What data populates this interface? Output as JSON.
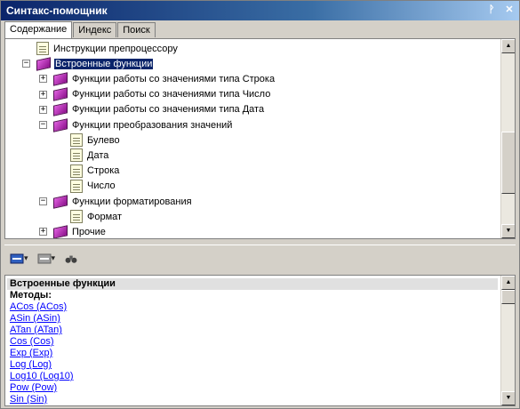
{
  "window": {
    "title": "Синтакс-помощник"
  },
  "tabs": [
    {
      "label": "Содержание",
      "active": true
    },
    {
      "label": "Индекс",
      "active": false
    },
    {
      "label": "Поиск",
      "active": false
    }
  ],
  "tree": [
    {
      "label": "Инструкции препроцессору",
      "icon": "document-icon",
      "expander": "",
      "selected": false
    },
    {
      "label": "Встроенные функции",
      "icon": "book-icon",
      "expander": "−",
      "selected": true
    },
    {
      "label": "Функции работы со значениями типа Строка",
      "icon": "book-icon",
      "expander": "+",
      "selected": false
    },
    {
      "label": "Функции работы со значениями типа Число",
      "icon": "book-icon",
      "expander": "+",
      "selected": false
    },
    {
      "label": "Функции работы со значениями типа Дата",
      "icon": "book-icon",
      "expander": "+",
      "selected": false
    },
    {
      "label": "Функции преобразования значений",
      "icon": "book-icon",
      "expander": "−",
      "selected": false
    },
    {
      "label": "Булево",
      "icon": "document-icon",
      "expander": "",
      "selected": false
    },
    {
      "label": "Дата",
      "icon": "document-icon",
      "expander": "",
      "selected": false
    },
    {
      "label": "Строка",
      "icon": "document-icon",
      "expander": "",
      "selected": false
    },
    {
      "label": "Число",
      "icon": "document-icon",
      "expander": "",
      "selected": false
    },
    {
      "label": "Функции форматирования",
      "icon": "book-icon",
      "expander": "−",
      "selected": false
    },
    {
      "label": "Формат",
      "icon": "document-icon",
      "expander": "",
      "selected": false
    },
    {
      "label": "Прочие",
      "icon": "book-icon",
      "expander": "+",
      "selected": false
    }
  ],
  "content": {
    "header": "Встроенные функции",
    "methods_label": "Методы:",
    "links": [
      "ACos (ACos)",
      "ASin (ASin)",
      "ATan (ATan)",
      "Cos (Cos)",
      "Exp (Exp)",
      "Log (Log)",
      "Log10 (Log10)",
      "Pow (Pow)",
      "Sin (Sin)"
    ]
  },
  "colors": {
    "title_bar": "#0a246a",
    "selection": "#0a246a",
    "link": "#0000ff"
  }
}
